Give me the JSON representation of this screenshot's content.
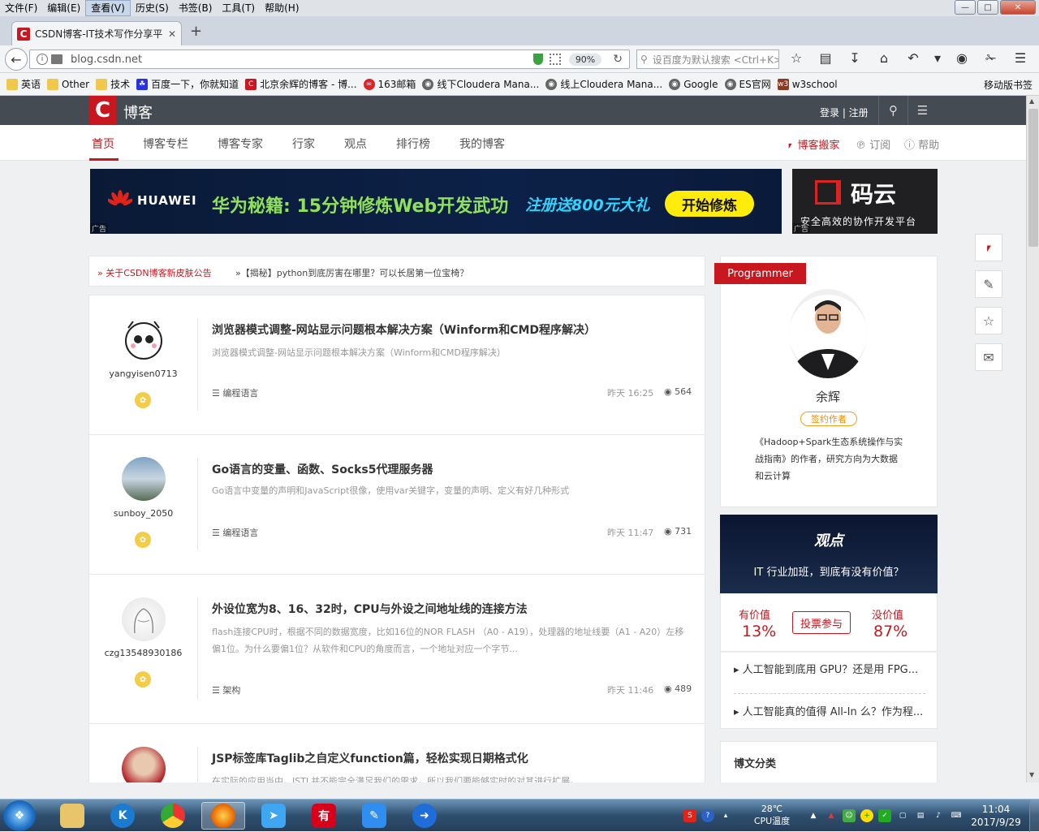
{
  "menubar": [
    "文件(F)",
    "编辑(E)",
    "查看(V)",
    "历史(S)",
    "书签(B)",
    "工具(T)",
    "帮助(H)"
  ],
  "tab": {
    "title": "CSDN博客-IT技术写作分享平台",
    "favicon": "C"
  },
  "address": {
    "url": "blog.csdn.net",
    "zoom": "90%",
    "search_placeholder": "设百度为默认搜索 <Ctrl+K>"
  },
  "bookmarks": [
    {
      "label": "英语",
      "icon": "folder-icon"
    },
    {
      "label": "Other",
      "icon": "folder-icon"
    },
    {
      "label": "技术",
      "icon": "folder-icon"
    },
    {
      "label": "百度一下，你就知道",
      "icon": "baidu-icon"
    },
    {
      "label": "北京余辉的博客 - 博...",
      "icon": "csdn-icon"
    },
    {
      "label": "163邮箱",
      "icon": "netease-icon"
    },
    {
      "label": "线下Cloudera Mana...",
      "icon": "globe-icon"
    },
    {
      "label": "线上Cloudera Mana...",
      "icon": "globe-icon"
    },
    {
      "label": "Google",
      "icon": "globe-icon"
    },
    {
      "label": "ES官网",
      "icon": "globe-icon"
    },
    {
      "label": "w3school",
      "icon": "w3-icon"
    }
  ],
  "mobile_bookmarks": "移动版书签",
  "site": {
    "logo": "C",
    "title": "博客",
    "login": "登录 | 注册"
  },
  "subnav": [
    "首页",
    "博客专栏",
    "博客专家",
    "行家",
    "观点",
    "排行榜",
    "我的博客"
  ],
  "subnav_right": [
    "博客搬家",
    "订阅",
    "帮助"
  ],
  "banner": {
    "brand": "HUAWEI",
    "headline": "华为秘籍: 15分钟修炼Web开发武功",
    "gift": "注册送800元大礼",
    "cta": "开始修炼",
    "ad": "广告"
  },
  "side_ad": {
    "name": "码云",
    "tagline": "安全高效的协作开发平台",
    "ad": "广告"
  },
  "notices": [
    "» 关于CSDN博客新皮肤公告",
    "»【揭秘】python到底厉害在哪里？可以长居第一位宝椅？"
  ],
  "posts": [
    {
      "user": "yangyisen0713",
      "title": "浏览器模式调整-网站显示问题根本解决方案（Winform和CMD程序解决）",
      "desc": "浏览器模式调整-网站显示问题根本解决方案（Winform和CMD程序解决）",
      "category": "编程语言",
      "time": "昨天 16:25",
      "views": "564"
    },
    {
      "user": "sunboy_2050",
      "title": "Go语言的变量、函数、Socks5代理服务器",
      "desc": "Go语言中变量的声明和JavaScript很像，使用var关键字，变量的声明、定义有好几种形式",
      "category": "编程语言",
      "time": "昨天 11:47",
      "views": "731"
    },
    {
      "user": "czg13548930186",
      "title": "外设位宽为8、16、32时，CPU与外设之间地址线的连接方法",
      "desc": "flash连接CPU时，根据不同的数据宽度，比如16位的NOR FLASH （A0 - A19），处理器的地址线要（A1 - A20）左移偏1位。为什么要偏1位？从软件和CPU的角度而言，一个地址对应一个字节...",
      "category": "架构",
      "time": "昨天 11:46",
      "views": "489"
    },
    {
      "user": "",
      "title": "JSP标签库Taglib之自定义function篇，轻松实现日期格式化",
      "desc": "在实际的应用当中，JSTL并不能完全满足我们的需求，所以我们要能够实时的对其进行扩展。",
      "category": "",
      "time": "",
      "views": ""
    }
  ],
  "author": {
    "tag": "Programmer",
    "name": "余辉",
    "badge": "签约作者",
    "bio": "《Hadoop+Spark生态系统操作与实战指南》的作者，研究方向为大数据和云计算"
  },
  "opinion": {
    "logo": "观点",
    "question": "IT 行业加班，到底有没有价值？",
    "yes_label": "有价值",
    "yes_pct": "13%",
    "vote_btn": "投票参与",
    "no_label": "没价值",
    "no_pct": "87%",
    "links": [
      "人工智能到底用 GPU？还是用 FPG...",
      "人工智能真的值得 All-In 么？作为程..."
    ]
  },
  "categories_title": "博文分类",
  "taskbar": {
    "temp": "28℃",
    "temp_label": "CPU温度",
    "time": "11:04",
    "date": "2017/9/29"
  },
  "colors": {
    "accent": "#c8171e",
    "header": "#444b53"
  }
}
